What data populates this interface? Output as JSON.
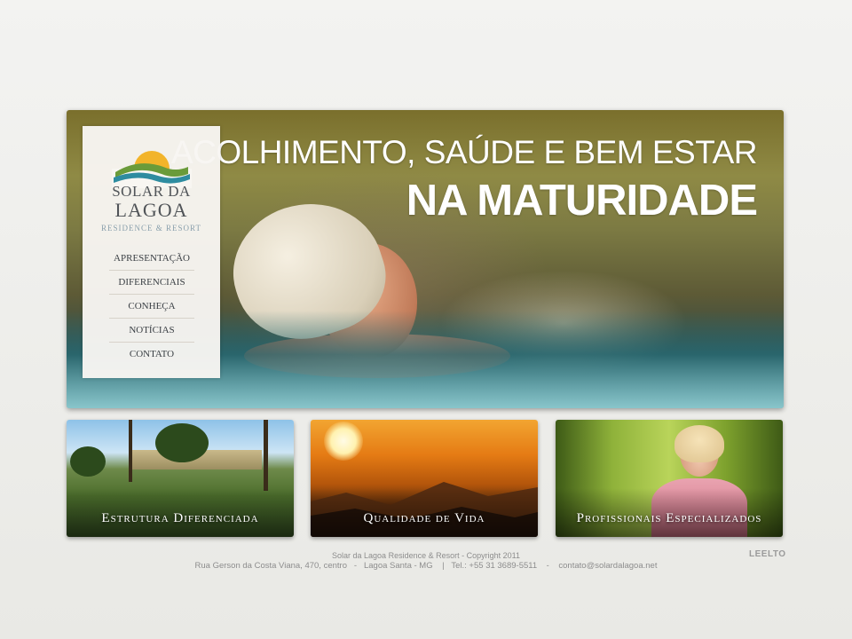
{
  "hero": {
    "headline_line1": "ACOLHIMENTO, SAÚDE E BEM ESTAR",
    "headline_line2": "NA MATURIDADE"
  },
  "logo": {
    "name_line1": "SOLAR DA",
    "name_line2": "LAGOA",
    "tagline": "RESIDENCE & RESORT",
    "colors": {
      "sun": "#f2b42a",
      "water": "#2e8ca0",
      "hill": "#6a9b3a"
    }
  },
  "menu": {
    "items": [
      {
        "label": "APRESENTAÇÃO"
      },
      {
        "label": "DIFERENCIAIS"
      },
      {
        "label": "CONHEÇA"
      },
      {
        "label": "NOTÍCIAS"
      },
      {
        "label": "CONTATO"
      }
    ]
  },
  "cards": [
    {
      "label": "Estrutura Diferenciada"
    },
    {
      "label": "Qualidade de Vida"
    },
    {
      "label": "Profissionais Especializados"
    }
  ],
  "footer": {
    "copyright": "Solar da Lagoa Residence & Resort - Copyright 2011",
    "address": "Rua Gerson da Costa Viana, 470, centro   -   Lagoa Santa - MG    |   Tel.: +55 31 3689-5511    -    contato@solardalagoa.net",
    "credit": "LEELTO"
  }
}
